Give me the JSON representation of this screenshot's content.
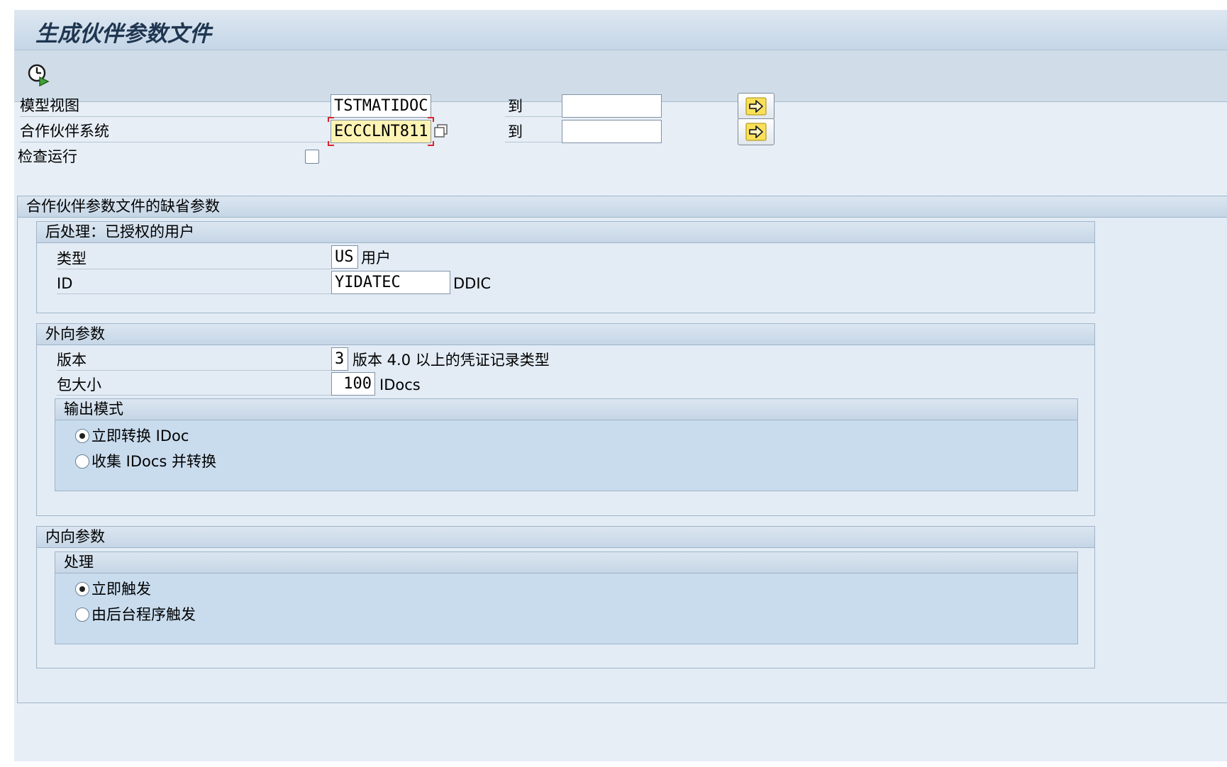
{
  "window": {
    "title": "生成伙伴参数文件"
  },
  "toolbar": {
    "execute_icon": "execute-clock-icon"
  },
  "selection": {
    "model_view": {
      "label": "模型视图",
      "value": "TSTMATIDOC",
      "to_label": "到",
      "to_value": ""
    },
    "partner_system": {
      "label": "合作伙伴系统",
      "value": "ECCCLNT811",
      "to_label": "到",
      "to_value": ""
    },
    "test_run": {
      "label": "检查运行",
      "checked": false
    }
  },
  "defaults_section": {
    "title": "合作伙伴参数文件的缺省参数",
    "post_processing": {
      "title": "后处理：已授权的用户",
      "type_label": "类型",
      "type_value": "US",
      "type_desc": "用户",
      "id_label": "ID",
      "id_value": "YIDATEC",
      "id_desc": "DDIC"
    },
    "outbound": {
      "title": "外向参数",
      "version_label": "版本",
      "version_value": "3",
      "version_desc": "版本 4.0 以上的凭证记录类型",
      "pack_label": "包大小",
      "pack_value": "100",
      "pack_desc": "IDocs",
      "output_mode": {
        "title": "输出模式",
        "options": [
          "立即转换 IDoc",
          "收集 IDocs 并转换"
        ],
        "selected": 0
      }
    },
    "inbound": {
      "title": "内向参数",
      "processing": {
        "title": "处理",
        "options": [
          "立即触发",
          "由后台程序触发"
        ],
        "selected": 0
      }
    }
  }
}
